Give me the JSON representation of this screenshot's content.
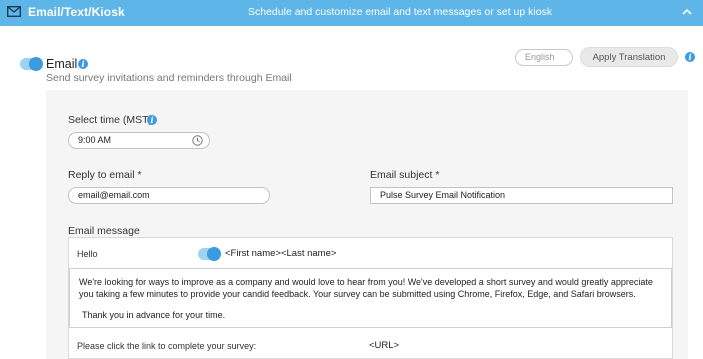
{
  "header": {
    "title": "Email/Text/Kiosk",
    "subtitle": "Schedule and customize email and text messages or set up kiosk",
    "icon": "envelope-icon",
    "collapse_icon": "chevron-up-icon",
    "color": "#5db5e8"
  },
  "email_section": {
    "enabled": true,
    "title": "Email",
    "description": "Send survey invitations and reminders through Email",
    "language": "English",
    "apply_translation_label": "Apply Translation"
  },
  "form": {
    "select_time_label": "Select time (MST)",
    "time_value": "9:00 AM",
    "reply_to_label": "Reply to email *",
    "reply_to_value": "email@email.com",
    "subject_label": "Email subject *",
    "subject_value": "Pulse Survey Email Notification",
    "message_label": "Email message"
  },
  "message": {
    "greeting": "Hello",
    "name_toggle_on": true,
    "name_placeholder": "<First name><Last name>",
    "body": "We're looking for ways to improve as a company and would love to hear from you! We've developed a short survey and would greatly appreciate you taking a few minutes to provide your candid feedback. Your survey can be submitted using Chrome, Firefox, Edge, and Safari browsers.",
    "closing": "Thank you in advance for your time.",
    "link_prompt": "Please click the link to complete your survey:",
    "url_placeholder": "<URL>"
  },
  "colors": {
    "accent": "#3a9be0",
    "panel_bg": "#f5f5f5"
  }
}
